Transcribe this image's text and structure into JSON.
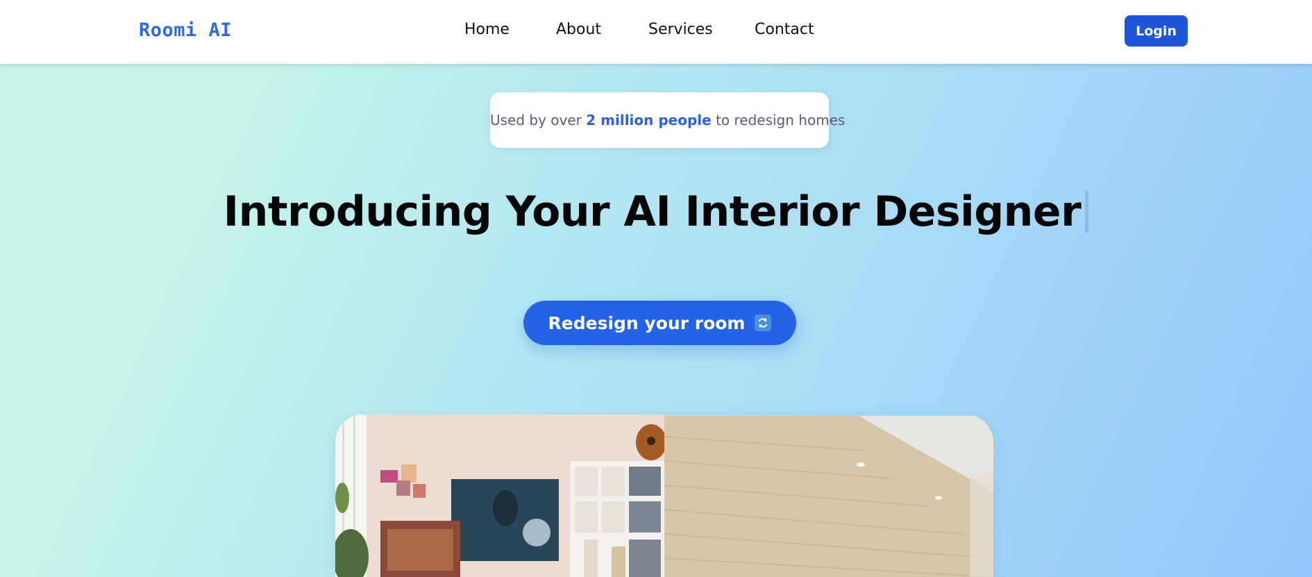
{
  "header": {
    "logo": "Roomi AI",
    "nav": [
      "Home",
      "About",
      "Services",
      "Contact"
    ],
    "login_label": "Login"
  },
  "badge": {
    "prefix": "Used by over",
    "highlight": "2 million people",
    "suffix": "to redesign homes"
  },
  "hero": {
    "title": "Introducing Your AI Interior Designer"
  },
  "cta": {
    "label": "Redesign your room",
    "icon": "refresh-icon"
  },
  "comparison": {
    "left_icon": "before-room-photo",
    "right_icon": "after-room-photo"
  },
  "colors": {
    "brand": "#2f6be0",
    "button": "#2563e6",
    "login": "#1f56d9",
    "highlight": "#2d62d8"
  }
}
